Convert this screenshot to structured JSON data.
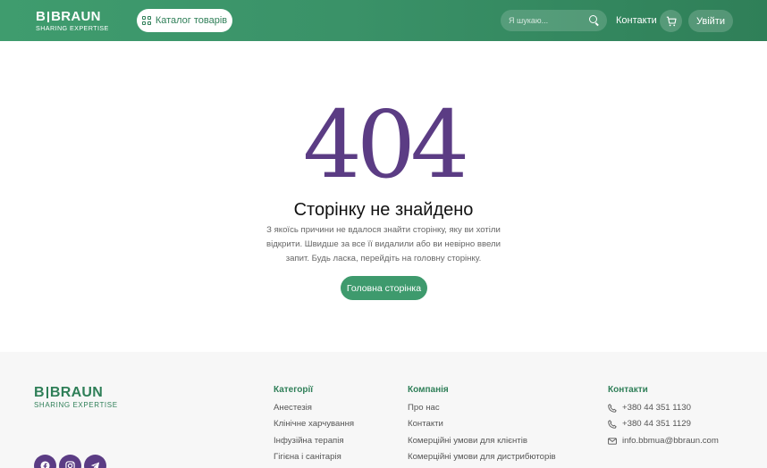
{
  "header": {
    "logo_main": "BRAUN",
    "logo_initial": "B",
    "logo_sub": "SHARING EXPERTISE",
    "catalog_label": "Каталог товарів",
    "search_placeholder": "Я шукаю...",
    "contacts_label": "Контакти",
    "login_label": "Увійти",
    "background_color": "#3a9268"
  },
  "main": {
    "error_code": "404",
    "title": "Сторінку не знайдено",
    "description": "З якоїсь причини не вдалося знайти сторінку, яку ви хотіли відкрити. Швидше за все її видалили або ви невірно ввели запит. Будь ласка, перейдіть на головну сторінку.",
    "home_button": "Головна сторінка",
    "accent_color": "#5b3c84",
    "button_color": "#3e9a6d"
  },
  "footer": {
    "logo_main": "BRAUN",
    "logo_initial": "B",
    "logo_sub": "SHARING EXPERTISE",
    "categories": {
      "heading": "Категорії",
      "items": [
        "Анестезія",
        "Клінічне харчування",
        "Інфузійна терапія",
        "Гігієна і санітарія"
      ]
    },
    "company": {
      "heading": "Компанія",
      "items": [
        "Про нас",
        "Контакти",
        "Комерційні умови для клієнтів",
        "Комерційні умови для дистрибюторів"
      ]
    },
    "contacts": {
      "heading": "Контакти",
      "phone1": "+380 44 351 1130",
      "phone2": "+380 44 351 1129",
      "email": "info.bbmua@bbraun.com"
    },
    "social": [
      "facebook-icon",
      "instagram-icon",
      "telegram-icon"
    ],
    "brand_color": "#2f7f58"
  }
}
